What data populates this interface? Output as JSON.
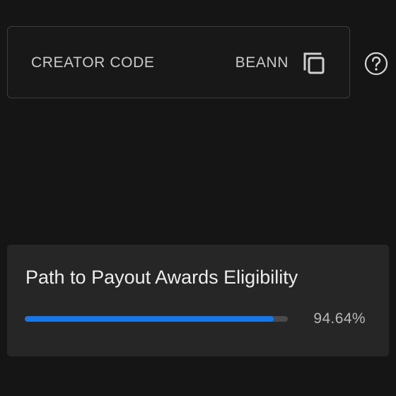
{
  "creator_code": {
    "label": "CREATOR CODE",
    "value": "BEANN",
    "copy_icon": "copy-icon",
    "help_icon": "question-circle-icon"
  },
  "payout": {
    "title": "Path to Payout Awards Eligibility",
    "progress_text": "94.64%",
    "progress_fraction": 0.9464
  },
  "colors": {
    "background": "#151515",
    "card": "#262626",
    "accent": "#1877e8",
    "track": "#4a4a4a"
  }
}
